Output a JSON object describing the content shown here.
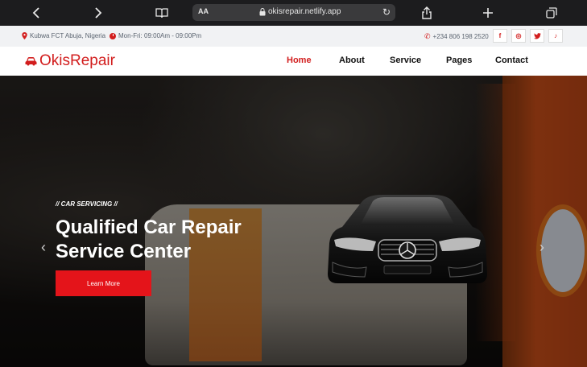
{
  "browser": {
    "text_size_label": "AA",
    "url": "okisrepair.netlify.app",
    "icons": [
      "back-icon",
      "forward-icon",
      "book-icon",
      "lock-icon",
      "reload-icon",
      "share-icon",
      "plus-icon",
      "tabs-icon"
    ]
  },
  "topbar": {
    "location": "Kubwa FCT Abuja, Nigeria",
    "hours": "Mon-Fri: 09:00Am - 09:00Pm",
    "phone": "+234 806 198 2520",
    "social": [
      {
        "name": "facebook-icon",
        "glyph": "f"
      },
      {
        "name": "instagram-icon",
        "glyph": "◎"
      },
      {
        "name": "twitter-icon",
        "glyph": "🐦"
      },
      {
        "name": "tiktok-icon",
        "glyph": "♪"
      }
    ]
  },
  "nav": {
    "brand": "OkisRepair",
    "links": [
      "Home",
      "About",
      "Service",
      "Pages",
      "Contact"
    ],
    "active": "Home"
  },
  "hero": {
    "tag": "// CAR SERVICING //",
    "title": "Qualified Car Repair Service Center",
    "cta": "Learn More",
    "prev_glyph": "‹",
    "next_glyph": "›"
  },
  "colors": {
    "accent": "#d21d1d",
    "button": "#e4141a",
    "browser_bg": "#1c1c1e",
    "info_bg": "#f1f2f4"
  }
}
